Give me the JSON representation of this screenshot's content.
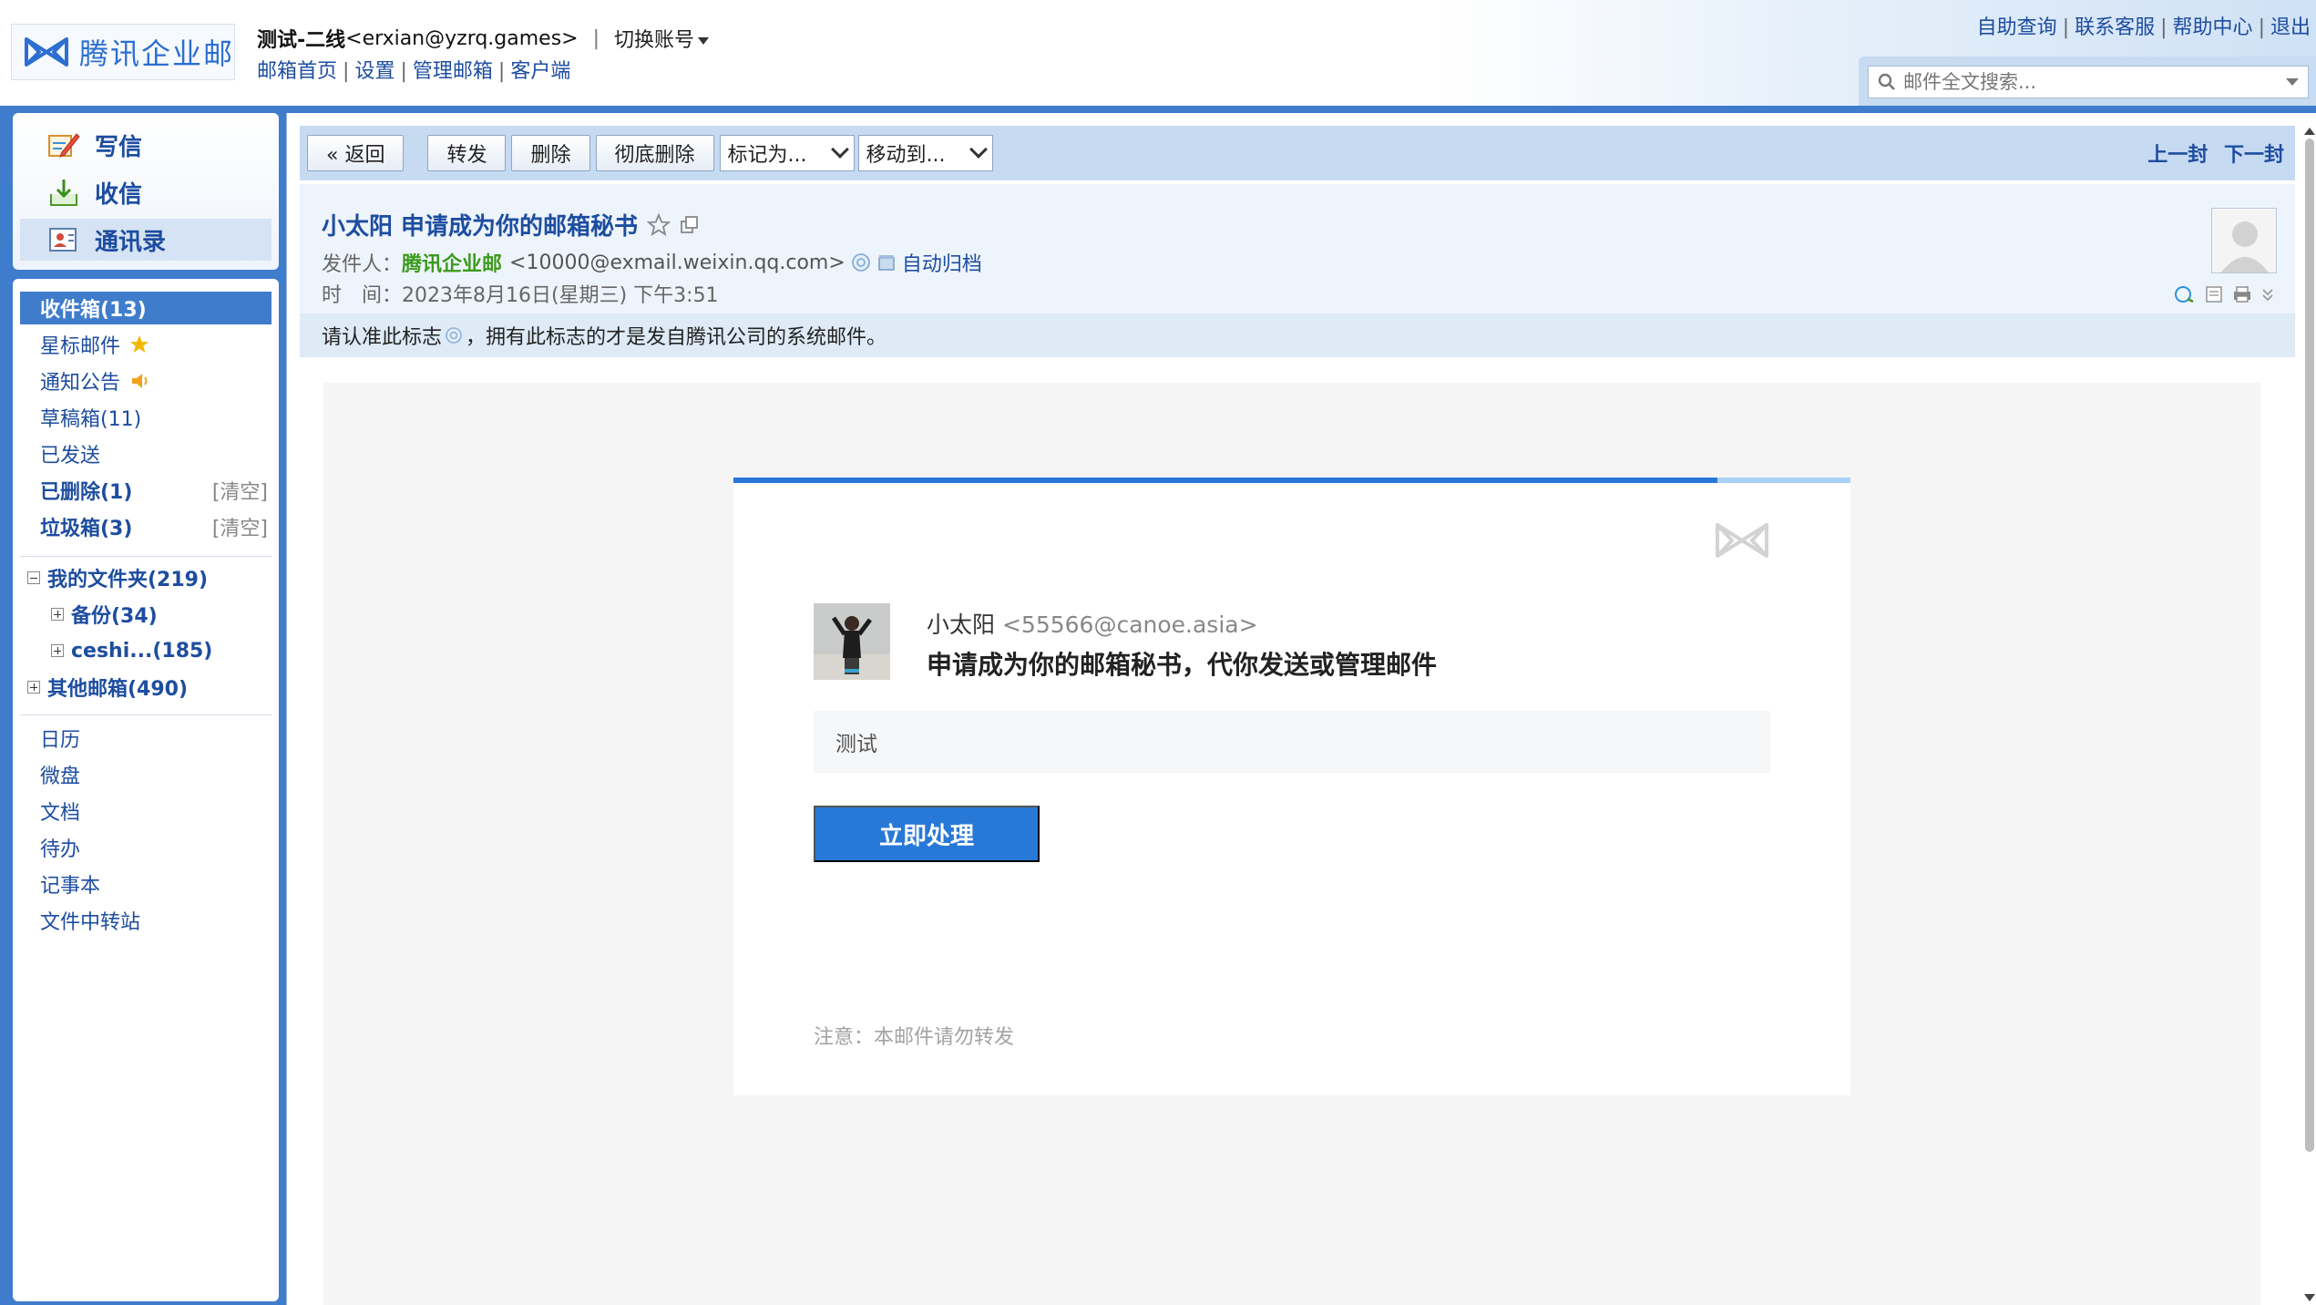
{
  "brand": {
    "name": "腾讯企业邮"
  },
  "account": {
    "name": "测试-二线",
    "email": "<erxian@yzrq.games>",
    "separator": "|",
    "switch_label": "切换账号"
  },
  "header_links": [
    "邮箱首页",
    "设置",
    "管理邮箱",
    "客户端"
  ],
  "top_right_links": [
    "自助查询",
    "联系客服",
    "帮助中心",
    "退出"
  ],
  "search": {
    "placeholder": "邮件全文搜索..."
  },
  "quick_actions": [
    {
      "label": "写信",
      "icon": "compose-icon"
    },
    {
      "label": "收信",
      "icon": "inbox-download-icon"
    },
    {
      "label": "通讯录",
      "icon": "contacts-icon"
    }
  ],
  "folders": {
    "inbox": "收件箱(13)",
    "starred": "星标邮件",
    "notice": "通知公告",
    "drafts": "草稿箱(11)",
    "sent": "已发送",
    "deleted": "已删除(1)",
    "spam": "垃圾箱(3)",
    "clear_label": "[清空]",
    "my_folders": "我的文件夹(219)",
    "backup": "备份(34)",
    "ceshi": "ceshi...(185)",
    "other_mailboxes": "其他邮箱(490)"
  },
  "apps": [
    "日历",
    "微盘",
    "文档",
    "待办",
    "记事本",
    "文件中转站"
  ],
  "toolbar": {
    "back": "« 返回",
    "forward": "转发",
    "delete": "删除",
    "delete_permanent": "彻底删除",
    "mark_as": "标记为...",
    "move_to": "移动到...",
    "prev": "上一封",
    "next": "下一封"
  },
  "mail": {
    "subject": "小太阳 申请成为你的邮箱秘书",
    "from_label": "发件人：",
    "sender_name": "腾讯企业邮",
    "sender_addr": "<10000@exmail.weixin.qq.com>",
    "archive_label": "自动归档",
    "time_label": "时　间：",
    "time_value": "2023年8月16日(星期三) 下午3:51",
    "notice_pre": "请认准此标志",
    "notice_post": "，拥有此标志的才是发自腾讯公司的系统邮件。"
  },
  "card": {
    "requester_name": "小太阳",
    "requester_email": "<55566@canoe.asia>",
    "title": "申请成为你的邮箱秘书，代你发送或管理邮件",
    "message": "测试",
    "action_button": "立即处理",
    "note": "注意：本邮件请勿转发"
  },
  "colors": {
    "brand_blue": "#3f7ccc",
    "link_blue": "#1d4da0",
    "action_blue": "#2878d8",
    "sender_green": "#3c9a1e"
  }
}
